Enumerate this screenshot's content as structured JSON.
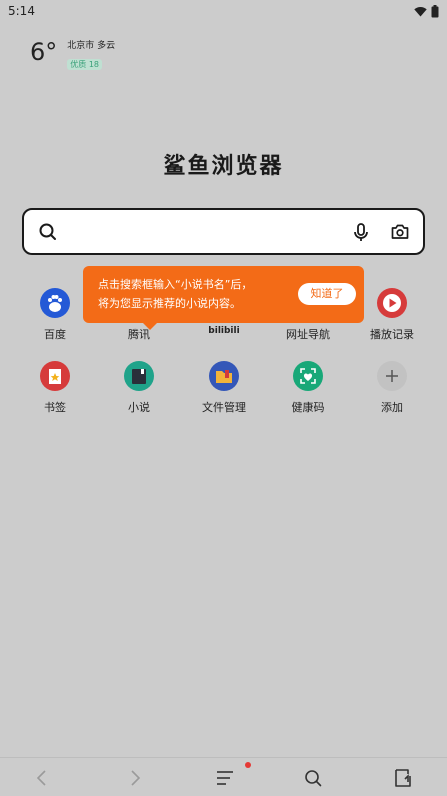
{
  "status": {
    "time": "5:14"
  },
  "weather": {
    "temp": "6°",
    "city": "北京市 多云",
    "aqi": "优质 18"
  },
  "logo": "鲨鱼浏览器",
  "tooltip": {
    "text": "点击搜索框输入“小说书名”后，\n将为您显示推荐的小说内容。",
    "button": "知道了"
  },
  "shortcuts": [
    {
      "label": "百度",
      "icon": "baidu-paw-icon",
      "color": "#2459d6"
    },
    {
      "label": "腾讯",
      "icon": "tencent-icon",
      "color": "#4a4a4a"
    },
    {
      "label": "bilibili",
      "icon": "bilibili-icon",
      "color": "#4a4a4a"
    },
    {
      "label": "网址导航",
      "icon": "nav-icon",
      "color": "#4a4a4a"
    },
    {
      "label": "播放记录",
      "icon": "play-icon",
      "color": "#d63b3b"
    },
    {
      "label": "书签",
      "icon": "bookmark-icon",
      "color": "#d63b3b"
    },
    {
      "label": "小说",
      "icon": "novel-book-icon",
      "color": "#1fa38a"
    },
    {
      "label": "文件管理",
      "icon": "folder-icon",
      "color": "#3457b8"
    },
    {
      "label": "健康码",
      "icon": "health-code-icon",
      "color": "#18a878"
    },
    {
      "label": "添加",
      "icon": "plus-icon",
      "color": "#c8c8c8"
    }
  ]
}
